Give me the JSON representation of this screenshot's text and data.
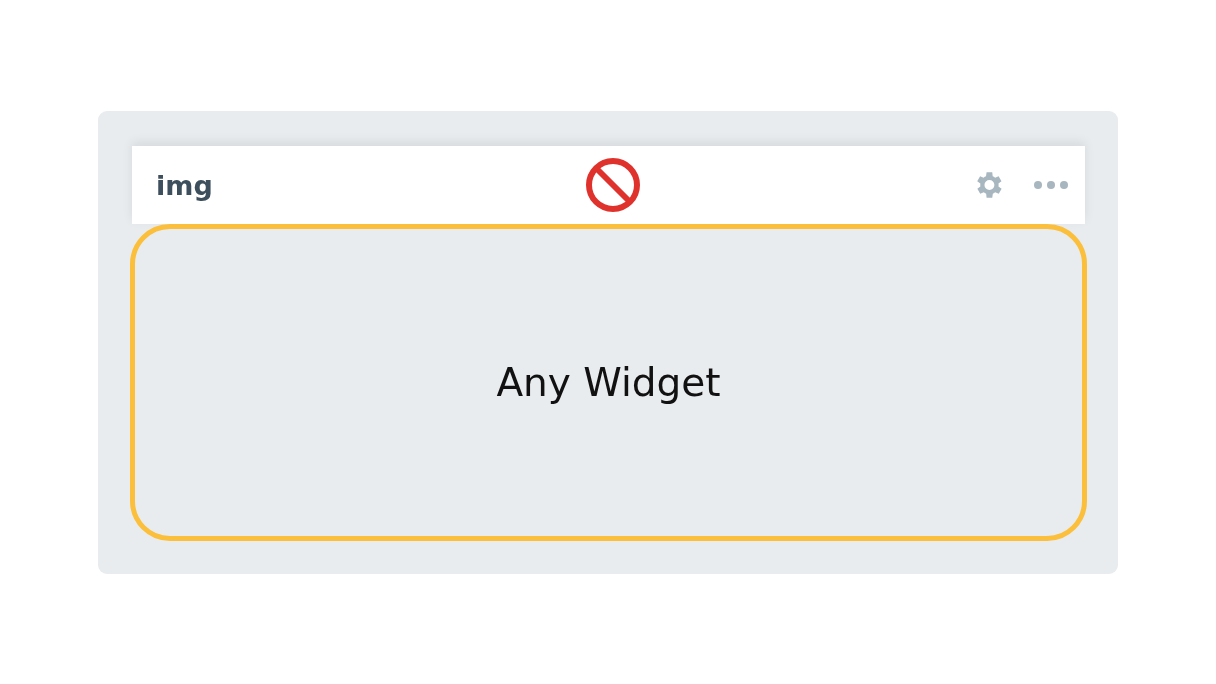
{
  "header": {
    "title": "img"
  },
  "widget": {
    "label": "Any Widget"
  }
}
